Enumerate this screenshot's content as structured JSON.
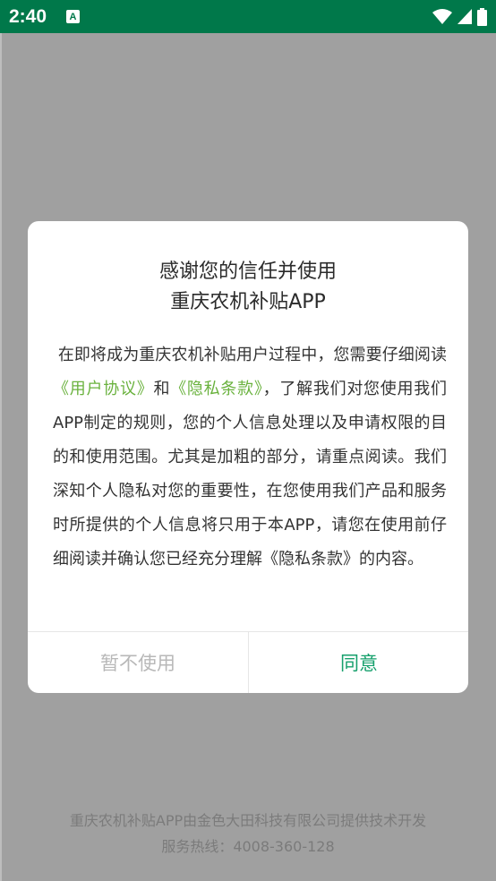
{
  "status_bar": {
    "time": "2:40",
    "app_icon_letter": "A"
  },
  "dialog": {
    "title_line1": "感谢您的信任并使用",
    "title_line2": "重庆农机补贴APP",
    "body": {
      "part1": "在即将成为重庆农机补贴用户过程中，您需要仔细阅读",
      "link_user_agreement": "《用户协议》",
      "part2": "和",
      "link_privacy": "《隐私条款》",
      "part3": "，了解我们对您使用我们APP制定的规则，您的个人信息处理以及申请权限的目的和使用范围。尤其是加粗的部分，请重点阅读。我们深知个人隐私对您的重要性，在您使用我们产品和服务时所提供的个人信息将只用于本APP，请您在使用前仔细阅读并确认您已经充分理解《隐私条款》的内容。"
    },
    "decline_label": "暂不使用",
    "agree_label": "同意"
  },
  "footer": {
    "line1": "重庆农机补贴APP由金色大田科技有限公司提供技术开发",
    "line2": "服务热线：4008-360-128"
  },
  "colors": {
    "status_bar": "#00784a",
    "link": "#6ab23e",
    "agree": "#16a06c",
    "overlay": "#a0a0a0"
  }
}
